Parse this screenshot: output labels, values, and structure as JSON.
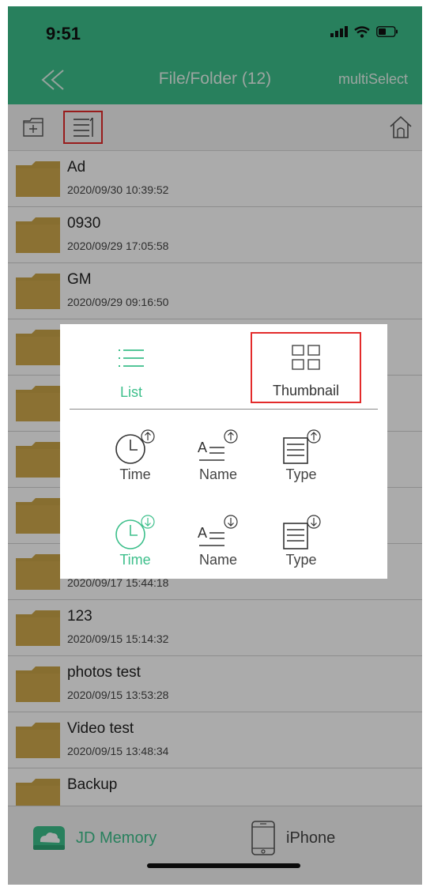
{
  "status": {
    "time": "9:51"
  },
  "nav": {
    "title": "File/Folder (12)",
    "multiselect": "multiSelect"
  },
  "colors": {
    "accent": "#3dbf8b",
    "folder": "#c9a448",
    "highlight": "#e32b2b"
  },
  "toolbar": {
    "icons": [
      "new-folder-icon",
      "sort-list-icon",
      "home-icon"
    ]
  },
  "files": [
    {
      "name": "Ad",
      "date": "2020/09/30 10:39:52"
    },
    {
      "name": "0930",
      "date": "2020/09/29 17:05:58"
    },
    {
      "name": "GM",
      "date": "2020/09/29 09:16:50"
    },
    {
      "name": "",
      "date": ""
    },
    {
      "name": "",
      "date": ""
    },
    {
      "name": "",
      "date": ""
    },
    {
      "name": "",
      "date": ""
    },
    {
      "name": "",
      "date": "2020/09/17 15:44:18"
    },
    {
      "name": "123",
      "date": "2020/09/15 15:14:32"
    },
    {
      "name": "photos test",
      "date": "2020/09/15 13:53:28"
    },
    {
      "name": "Video test",
      "date": "2020/09/15 13:48:34"
    },
    {
      "name": "Backup",
      "date": ""
    }
  ],
  "popup": {
    "view_list": "List",
    "view_thumbnail": "Thumbnail",
    "sort_up": {
      "time": "Time",
      "name": "Name",
      "type": "Type"
    },
    "sort_down": {
      "time": "Time",
      "name": "Name",
      "type": "Type"
    },
    "selected_view": "List",
    "selected_sort": "Time descending"
  },
  "tabs": {
    "jd": "JD Memory",
    "iphone": "iPhone"
  }
}
